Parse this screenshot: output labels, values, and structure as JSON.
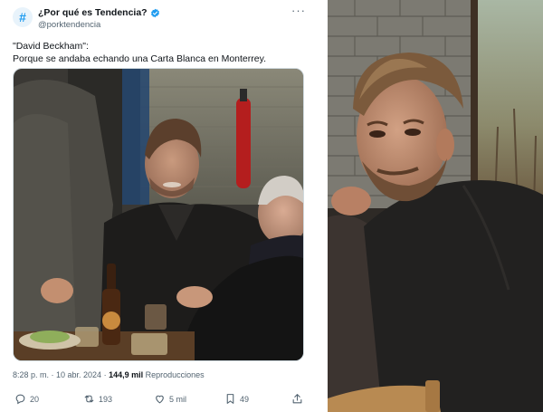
{
  "tweet": {
    "avatar_glyph": "#",
    "display_name": "¿Por qué es Tendencia?",
    "handle": "@porktendencia",
    "more_glyph": "···",
    "body_lines": [
      "\"David Beckham\":",
      "Porque se andaba echando una Carta Blanca en Monterrey."
    ],
    "timestamp": "8:28 p. m. · 10 abr. 2024 · ",
    "views": "144,9 mil",
    "views_label": " Reproducciones",
    "actions": {
      "replies": "20",
      "reposts": "193",
      "likes": "5 mil",
      "bookmarks": "49"
    }
  },
  "colors": {
    "accent": "#1d9bf0",
    "secondary_text": "#536471",
    "primary_text": "#0f1419"
  }
}
